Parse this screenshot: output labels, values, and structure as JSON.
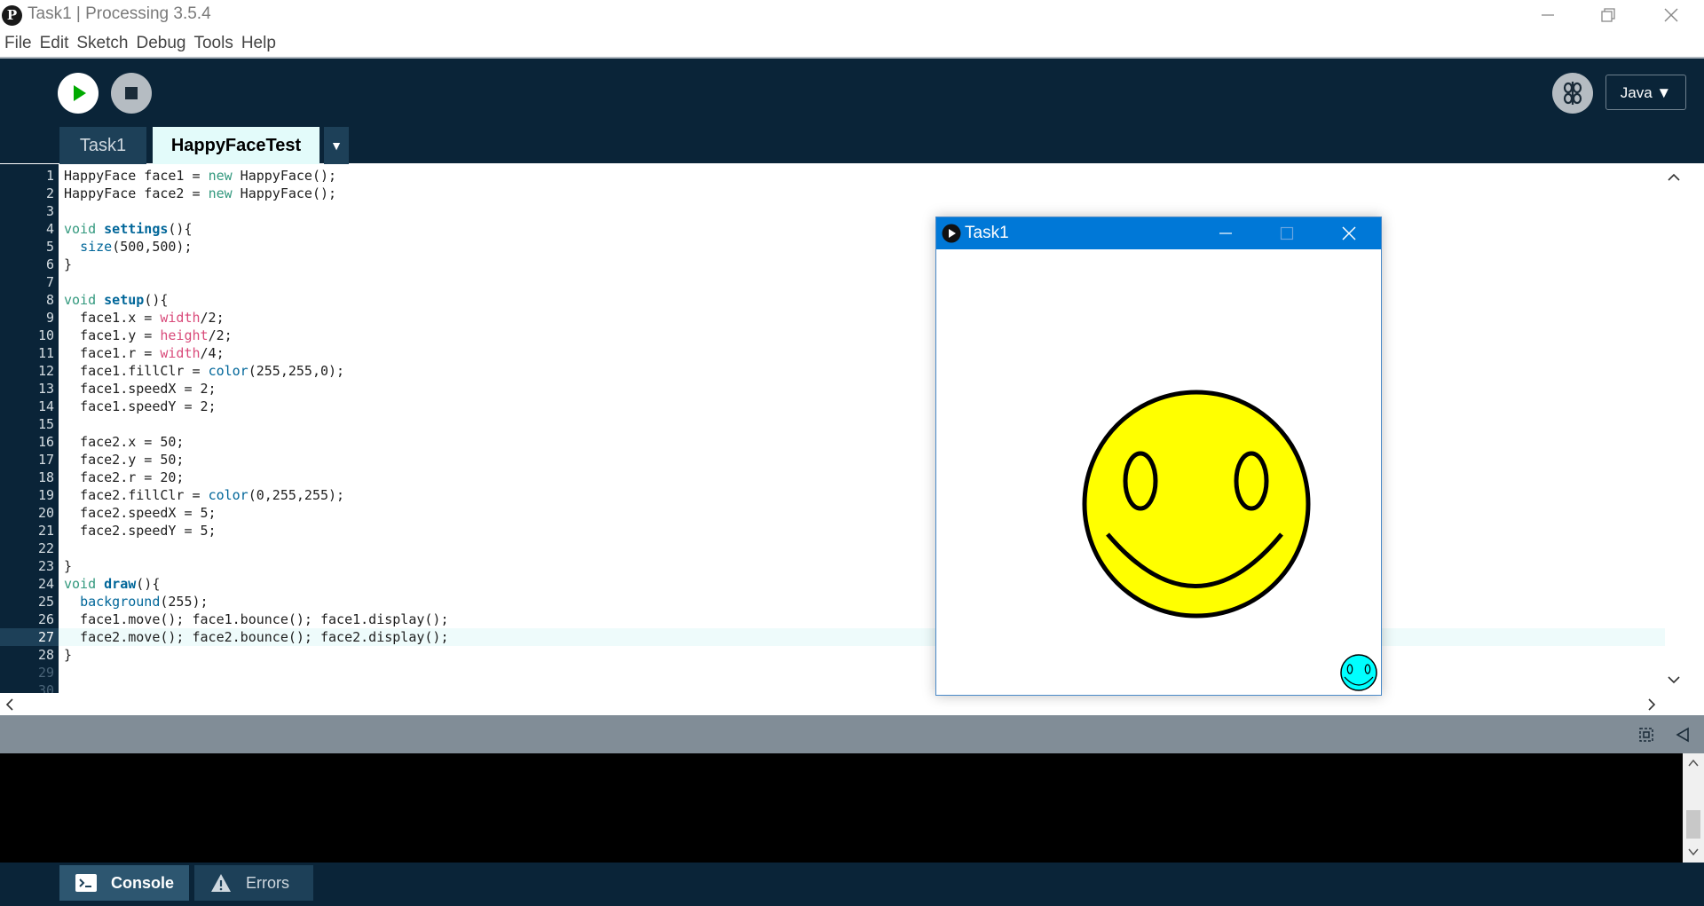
{
  "window": {
    "title": "Task1 | Processing 3.5.4",
    "logo_glyph": "P"
  },
  "menu": [
    "File",
    "Edit",
    "Sketch",
    "Debug",
    "Tools",
    "Help"
  ],
  "toolbar": {
    "mode": "Java ▼",
    "play_icon": "play-icon",
    "stop_icon": "stop-icon",
    "debug_icon": "debugger-icon"
  },
  "tabs": [
    {
      "label": "Task1",
      "active": false
    },
    {
      "label": "HappyFaceTest",
      "active": true
    }
  ],
  "tab_menu_glyph": "▼",
  "editor": {
    "current_line": 27,
    "lines": [
      "HappyFace face1 = new HappyFace();",
      "HappyFace face2 = new HappyFace();",
      "",
      "void settings(){",
      "  size(500,500);",
      "}",
      "",
      "void setup(){",
      "  face1.x = width/2;",
      "  face1.y = height/2;",
      "  face1.r = width/4;",
      "  face1.fillClr = color(255,255,0);",
      "  face1.speedX = 2;",
      "  face1.speedY = 2;",
      "",
      "  face2.x = 50;",
      "  face2.y = 50;",
      "  face2.r = 20;",
      "  face2.fillClr = color(0,255,255);",
      "  face2.speedX = 5;",
      "  face2.speedY = 5;",
      "",
      "}",
      "void draw(){",
      "  background(255);",
      "  face1.move(); face1.bounce(); face1.display();",
      "  face2.move(); face2.bounce(); face2.display();",
      "}",
      "",
      ""
    ]
  },
  "sketch_window": {
    "title": "Task1",
    "faces": [
      {
        "name": "face1",
        "color": "#ffff00"
      },
      {
        "name": "face2",
        "color": "#00ffff"
      }
    ]
  },
  "footer": {
    "console_label": "Console",
    "errors_label": "Errors"
  },
  "colors": {
    "dark_bg": "#0a2438",
    "tab_bg": "#1d4058",
    "active_tab": "#e3fbfa",
    "keyword": "#33997e",
    "function": "#006699",
    "variable": "#d94a7a",
    "play": "#00aa00"
  }
}
